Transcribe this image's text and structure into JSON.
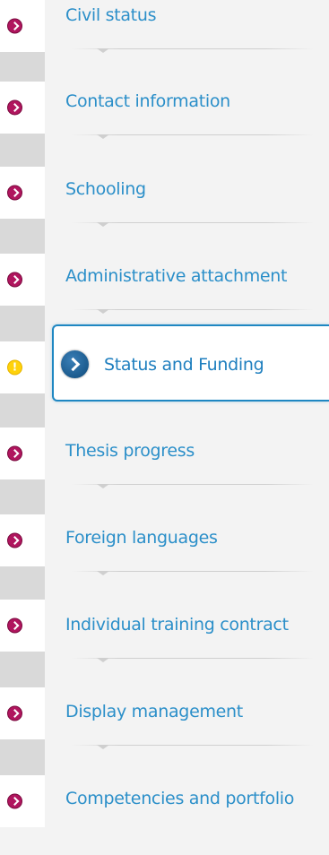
{
  "menu": {
    "items": [
      {
        "label": "Civil status",
        "status": "complete"
      },
      {
        "label": "Contact information",
        "status": "complete"
      },
      {
        "label": "Schooling",
        "status": "complete"
      },
      {
        "label": "Administrative attachment",
        "status": "complete"
      },
      {
        "label": "Status and Funding",
        "status": "warning",
        "active": true
      },
      {
        "label": "Thesis progress",
        "status": "complete"
      },
      {
        "label": "Foreign languages",
        "status": "complete"
      },
      {
        "label": "Individual training contract",
        "status": "complete"
      },
      {
        "label": "Display management",
        "status": "complete"
      },
      {
        "label": "Competencies and portfolio",
        "status": "complete"
      }
    ]
  },
  "colors": {
    "link": "#2b8fc9",
    "status_complete": "#b0155e",
    "status_warning": "#ffd20a",
    "active_border": "#1f87c2"
  },
  "icons": {
    "complete": "chevron-right-circle-icon",
    "warning": "exclamation-circle-icon",
    "active": "chevron-right-circle-icon"
  }
}
